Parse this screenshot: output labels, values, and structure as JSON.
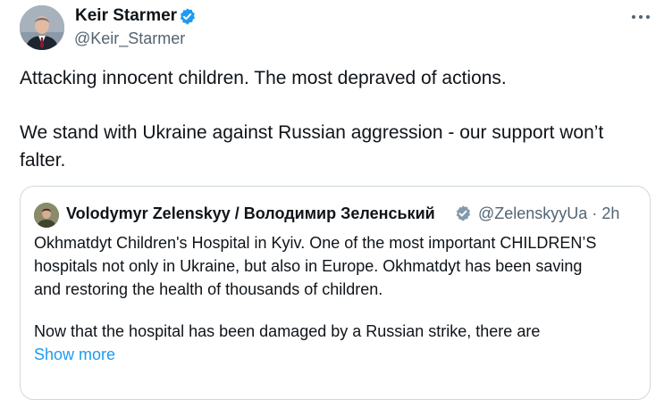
{
  "tweet": {
    "author": {
      "name": "Keir Starmer",
      "handle": "@Keir_Starmer",
      "verified_icon": "verified-badge-icon",
      "badge_color": "#1d9bf0"
    },
    "more_icon": "more-horizontal-icon",
    "text_lines": [
      "Attacking innocent children. The most depraved of actions.",
      "We stand with Ukraine against Russian aggression - our support won’t",
      "falter."
    ]
  },
  "quote": {
    "author": {
      "name": "Volodymyr Zelenskyy / Володимир Зеленський",
      "handle": "@ZelenskyyUa",
      "separator": "·",
      "time": "2h",
      "verified_icon": "verified-badge-icon"
    },
    "text_lines": [
      "Okhmatdyt Children's Hospital in Kyiv. One of the most important CHILDREN’S",
      "hospitals not only in Ukraine, but also in Europe. Okhmatdyt has been saving",
      "and restoring the health of thousands of children.",
      "Now that the hospital has been damaged by a Russian strike, there are"
    ],
    "show_more_label": "Show more",
    "link_color": "#1d9bf0"
  }
}
